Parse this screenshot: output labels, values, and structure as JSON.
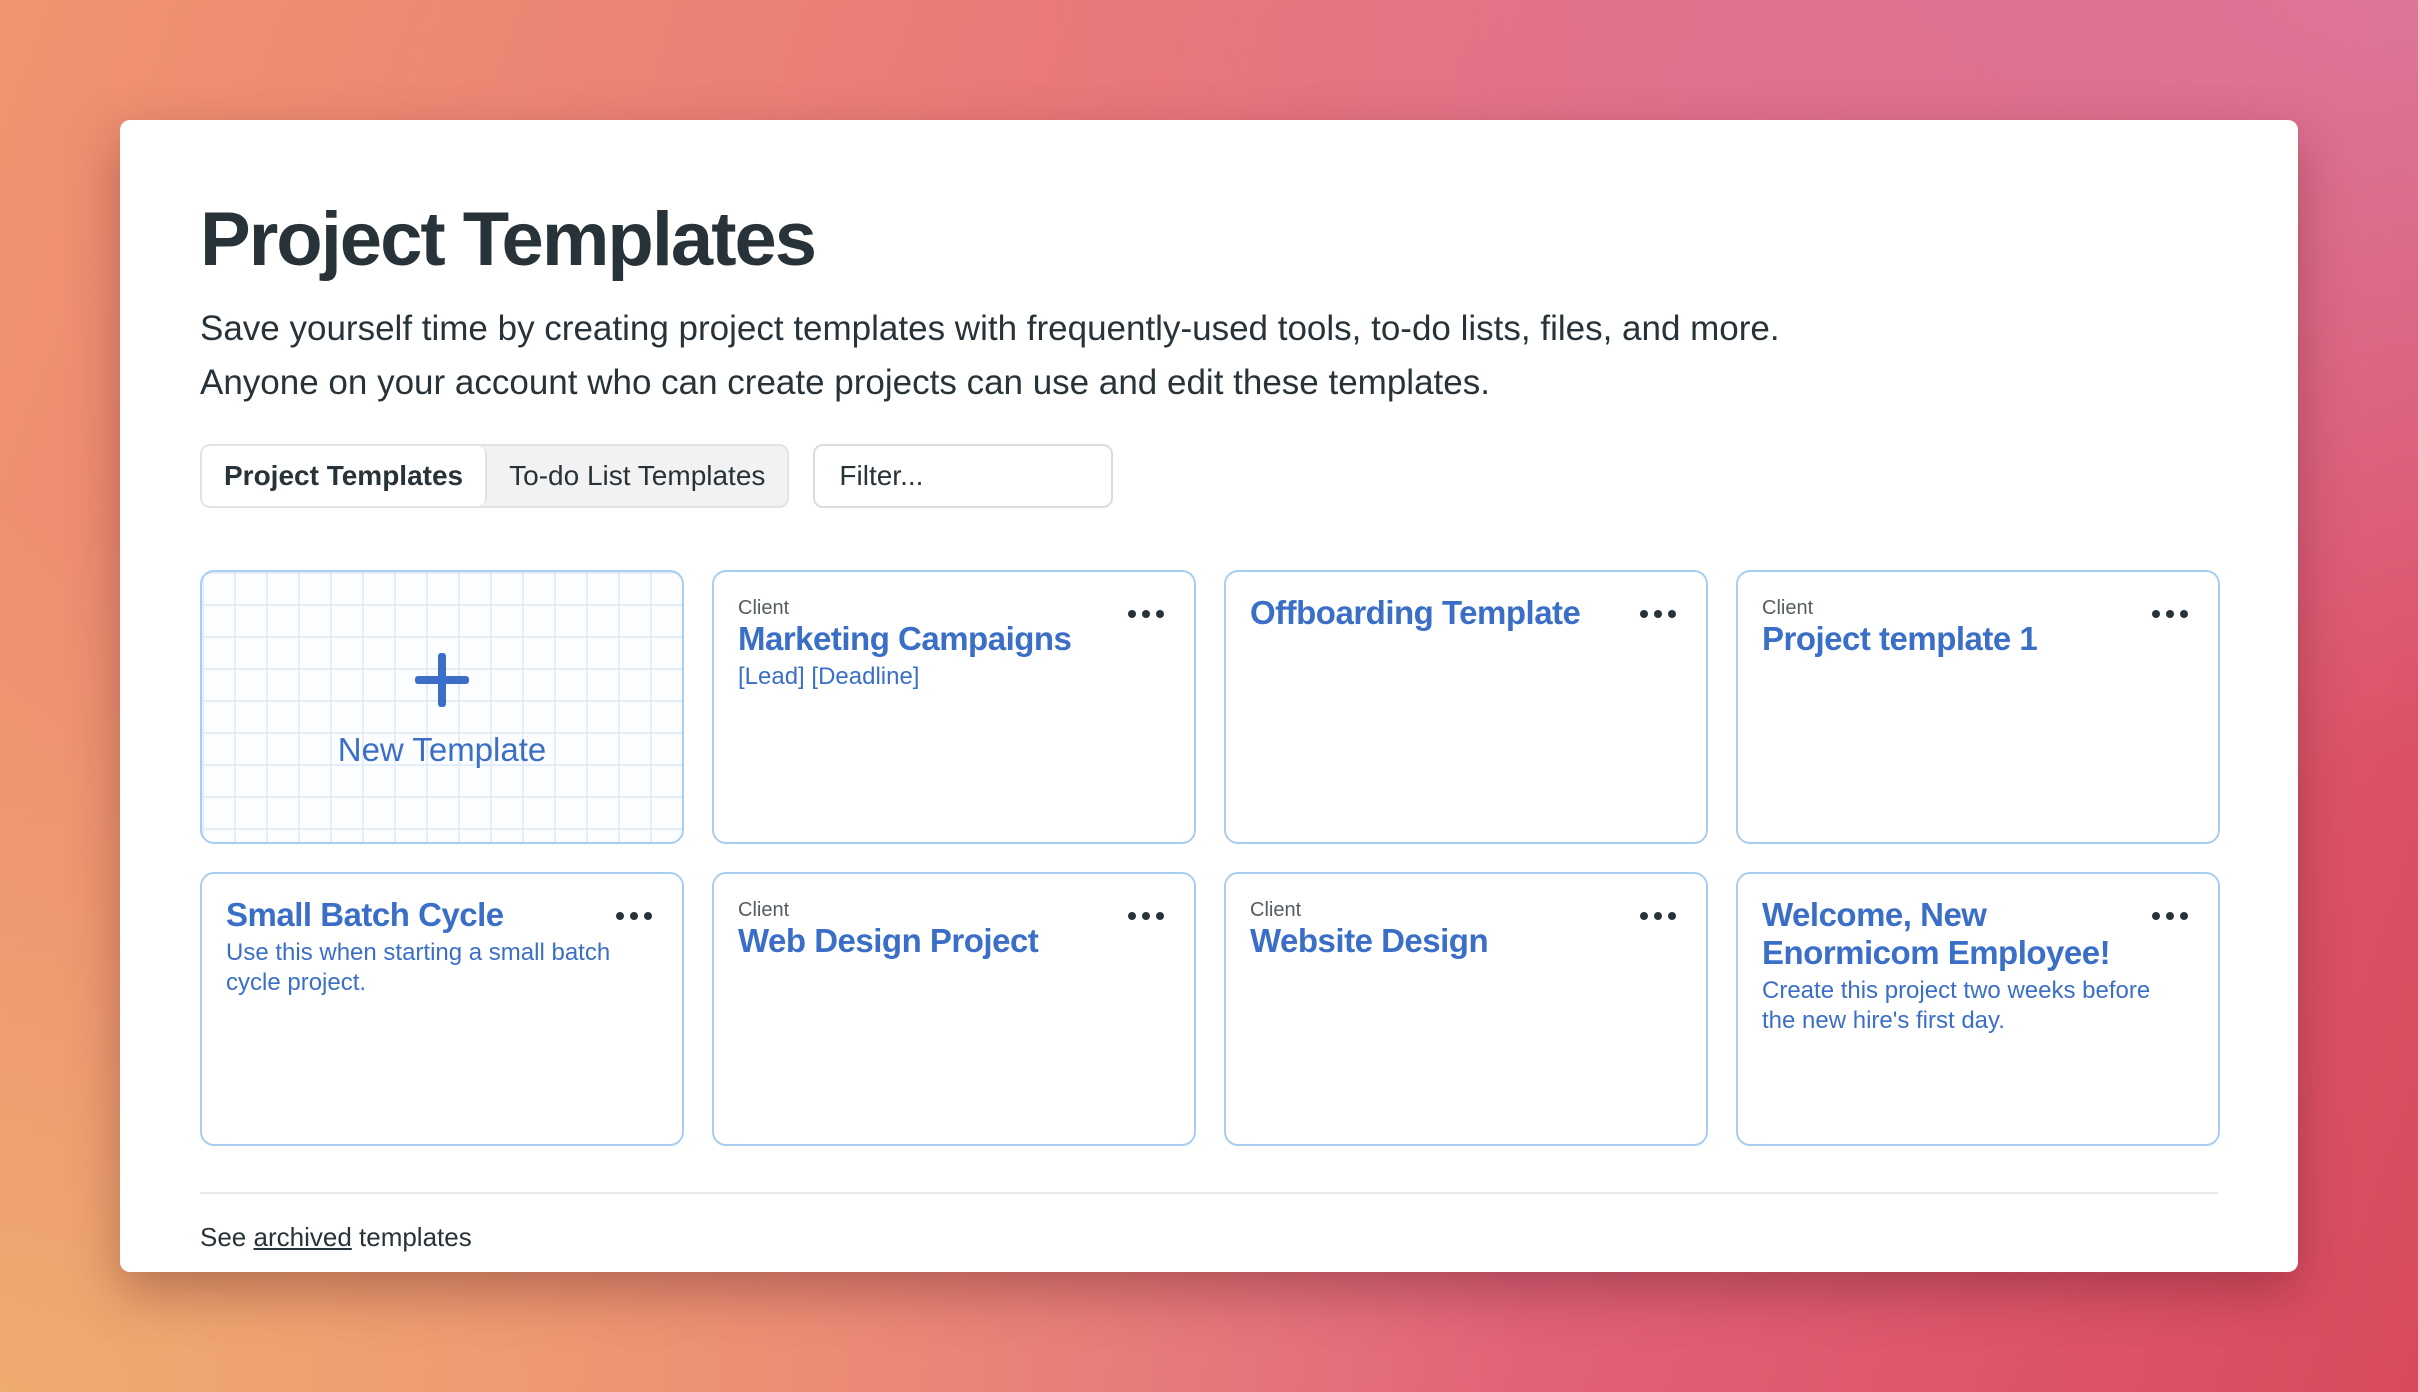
{
  "header": {
    "title": "Project Templates",
    "description": "Save yourself time by creating project templates with frequently-used tools, to-do lists, files, and more. Anyone on your account who can create projects can use and edit these templates."
  },
  "tabs": [
    {
      "label": "Project Templates",
      "active": true
    },
    {
      "label": "To-do List Templates",
      "active": false
    }
  ],
  "filter": {
    "placeholder": "Filter...",
    "value": ""
  },
  "new_template": {
    "label": "New Template",
    "icon": "plus-icon"
  },
  "templates": [
    {
      "eyebrow": "Client",
      "title": "Marketing Campaigns",
      "description": "[Lead] [Deadline]"
    },
    {
      "eyebrow": "",
      "title": "Offboarding Template",
      "description": ""
    },
    {
      "eyebrow": "Client",
      "title": "Project template 1",
      "description": ""
    },
    {
      "eyebrow": "",
      "title": "Small Batch Cycle",
      "description": "Use this when starting a small batch cycle project."
    },
    {
      "eyebrow": "Client",
      "title": "Web Design Project",
      "description": ""
    },
    {
      "eyebrow": "Client",
      "title": "Website Design",
      "description": ""
    },
    {
      "eyebrow": "",
      "title": "Welcome, New Enormicom Employee!",
      "description": "Create this project two weeks before the new hire's first day."
    }
  ],
  "footer": {
    "prefix": "See ",
    "link": "archived",
    "suffix": " templates"
  },
  "colors": {
    "accent": "#3b6fc7",
    "text": "#283339",
    "card_border": "#a8cdf0"
  }
}
